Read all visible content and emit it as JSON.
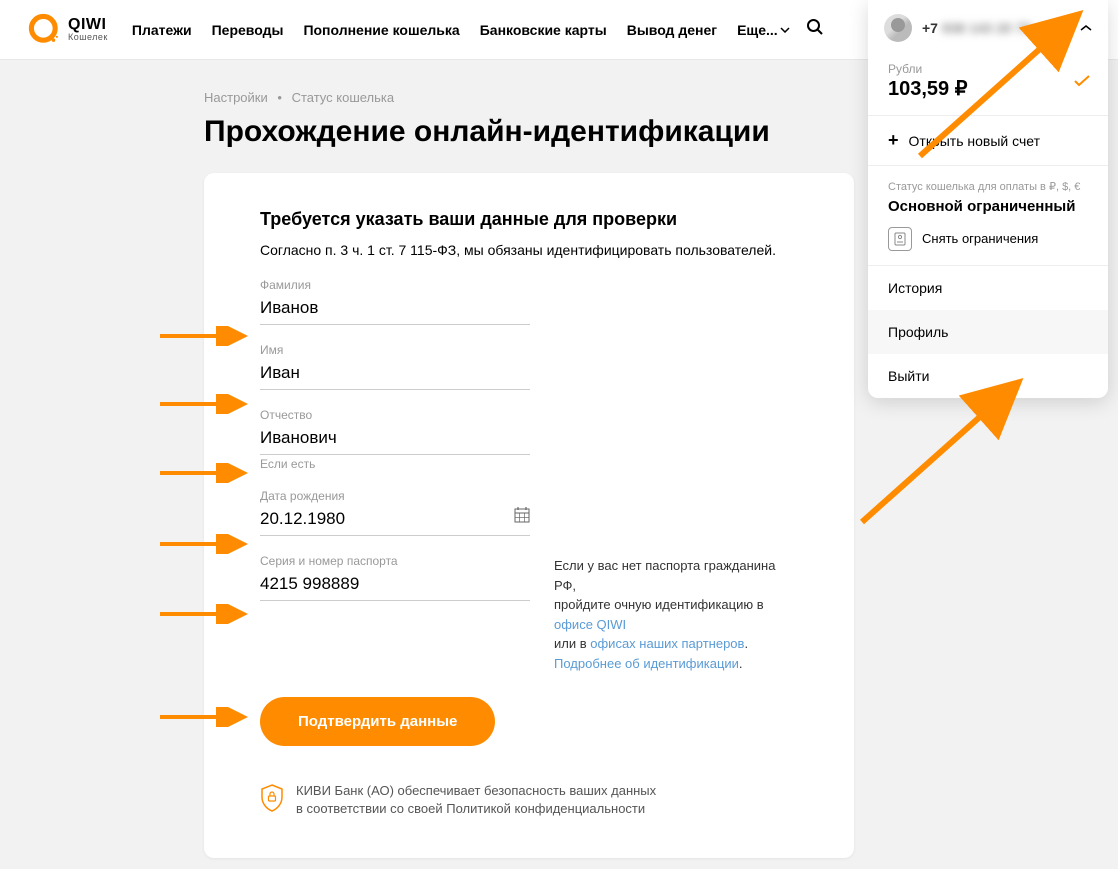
{
  "logo": {
    "brand": "QIWI",
    "sub": "Кошелек"
  },
  "nav": {
    "payments": "Платежи",
    "transfers": "Переводы",
    "topup": "Пополнение кошелька",
    "cards": "Банковские карты",
    "withdraw": "Вывод денег",
    "more": "Еще"
  },
  "breadcrumb": {
    "settings": "Настройки",
    "status": "Статус кошелька"
  },
  "page_title": "Прохождение онлайн-идентификации",
  "card": {
    "heading": "Требуется указать ваши данные для проверки",
    "law": "Согласно п. 3 ч. 1 ст. 7 115-ФЗ, мы обязаны идентифицировать пользователей.",
    "fields": {
      "lastname": {
        "label": "Фамилия",
        "value": "Иванов"
      },
      "firstname": {
        "label": "Имя",
        "value": "Иван"
      },
      "middlename": {
        "label": "Отчество",
        "value": "Иванович",
        "hint": "Если есть"
      },
      "dob": {
        "label": "Дата рождения",
        "value": "20.12.1980"
      },
      "passport": {
        "label": "Серия и номер паспорта",
        "value": "4215 998889"
      }
    },
    "note": {
      "l1": "Если у вас нет паспорта гражданина РФ,",
      "l2a": "пройдите очную идентификацию в ",
      "l2b": "офисе QIWI",
      "l3a": "или в ",
      "l3b": "офисах наших партнеров",
      "l3c": ".",
      "l4": "Подробнее об идентификации",
      "l4c": "."
    },
    "submit": "Подтвердить данные",
    "footer": {
      "l1": "КИВИ Банк (АО) обеспечивает безопасность ваших данных",
      "l2": "в соответствии со своей Политикой конфиденциальности"
    }
  },
  "profile": {
    "phone_prefix": "+7 ",
    "phone_blur": "938 143 20 75",
    "balance": {
      "currency": "Рубли",
      "amount": "103,59 ₽"
    },
    "new_account": "Открыть новый счет",
    "status": {
      "label": "Статус кошелька для оплаты в ₽, $, €",
      "value": "Основной ограниченный",
      "remove": "Снять ограничения"
    },
    "menu": {
      "history": "История",
      "profile": "Профиль",
      "logout": "Выйти"
    }
  }
}
